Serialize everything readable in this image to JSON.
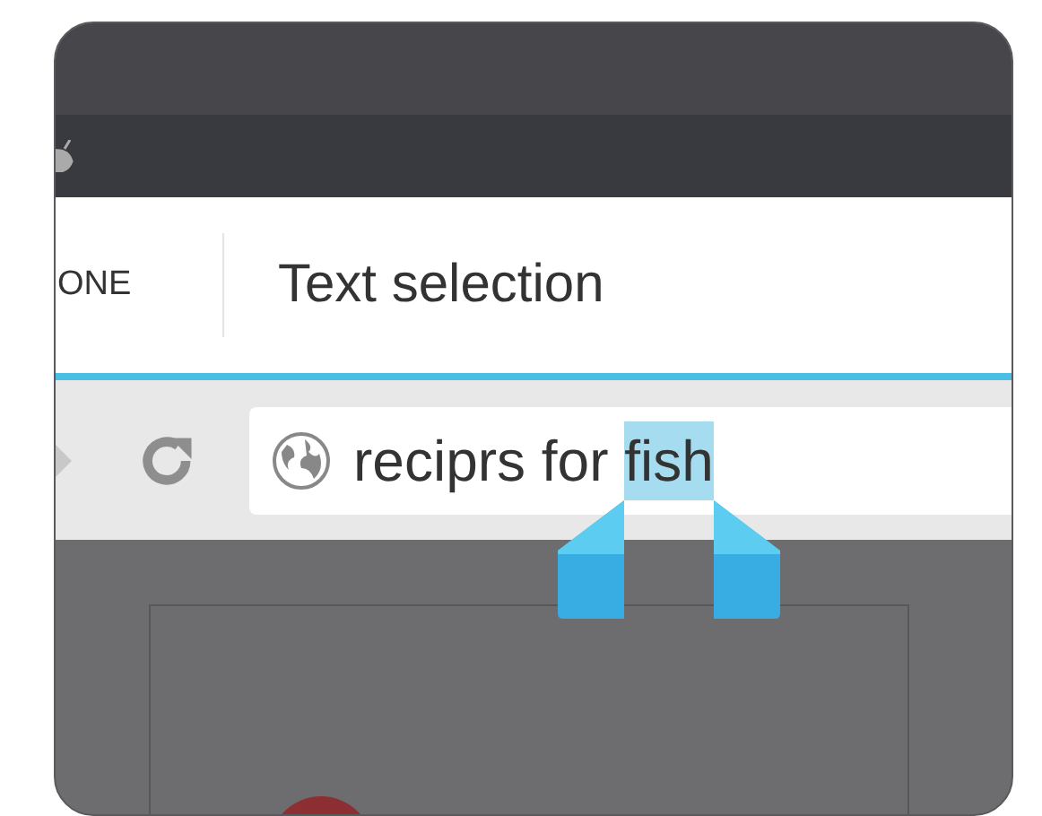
{
  "action_bar": {
    "action": "ONE",
    "title": "Text selection"
  },
  "address_bar": {
    "segments": [
      {
        "text": "reciprs for ",
        "selected": false
      },
      {
        "text": "fish",
        "selected": true
      }
    ]
  }
}
